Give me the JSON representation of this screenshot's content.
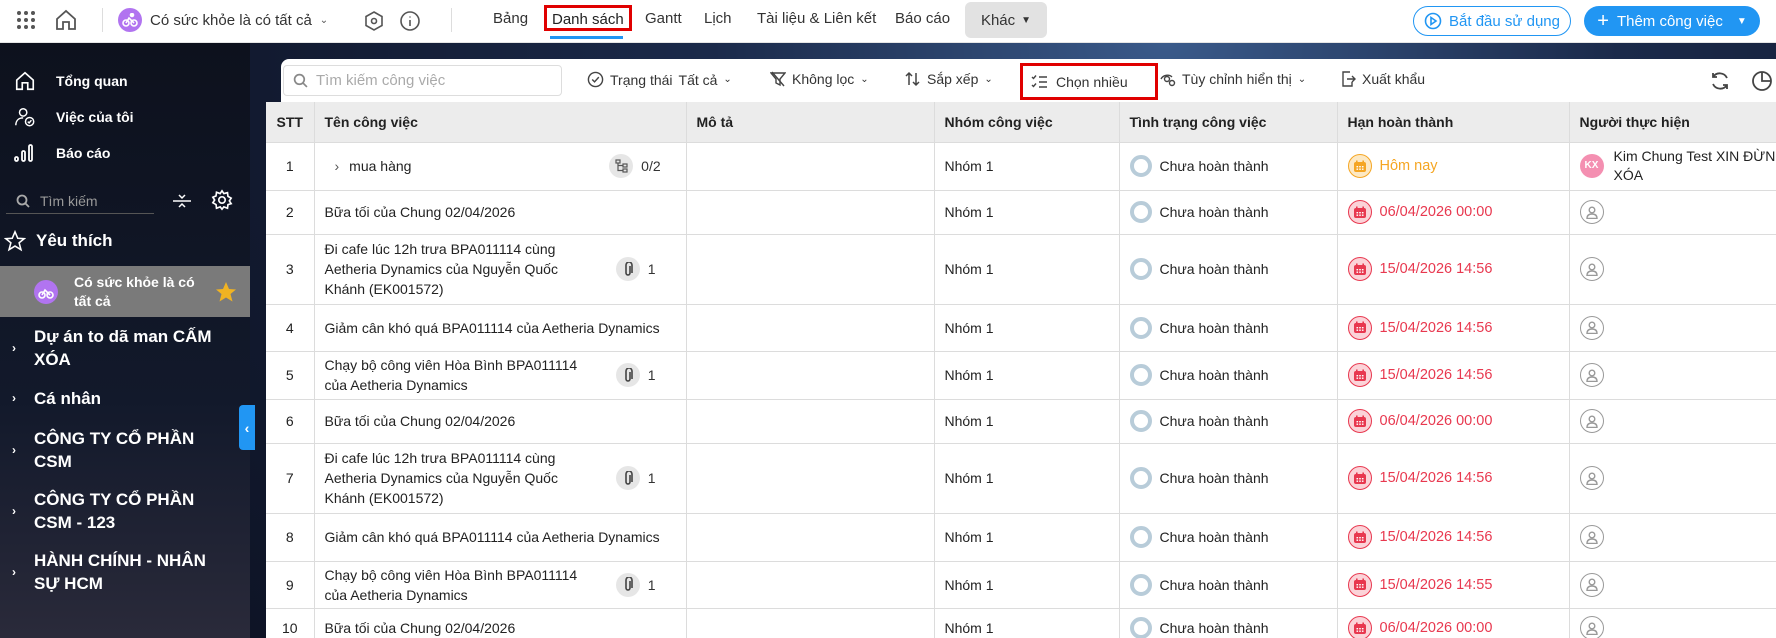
{
  "topbar": {
    "project_name": "Có sức khỏe là có tất cả",
    "tabs": [
      {
        "label": "Bảng"
      },
      {
        "label": "Danh sách",
        "active": true
      },
      {
        "label": "Gantt"
      },
      {
        "label": "Lịch"
      },
      {
        "label": "Tài liệu & Liên kết"
      },
      {
        "label": "Báo cáo"
      }
    ],
    "more_label": "Khác",
    "start_button": "Bắt đầu sử dụng",
    "add_button": "Thêm công việc",
    "accent": "#2196f3",
    "highlight": "#e00000"
  },
  "sidebar": {
    "nav": [
      {
        "label": "Tổng quan",
        "icon": "home-icon"
      },
      {
        "label": "Việc của tôi",
        "icon": "user-check-icon"
      },
      {
        "label": "Báo cáo",
        "icon": "bar-chart-icon"
      }
    ],
    "search_placeholder": "Tìm kiếm",
    "favorites_label": "Yêu thích",
    "favorite_item": "Có sức khỏe là có tất cả",
    "projects": [
      {
        "label": "Dự án to dã man CẤM XÓA"
      },
      {
        "label": "Cá nhân"
      },
      {
        "label": "CÔNG TY CỔ PHẦN CSM"
      },
      {
        "label": "CÔNG TY CỔ PHẦN CSM - 123"
      },
      {
        "label": "HÀNH CHÍNH - NHÂN SỰ HCM"
      }
    ]
  },
  "toolbar": {
    "search_placeholder": "Tìm kiếm công việc",
    "status_label": "Trạng thái",
    "status_value": "Tất cả",
    "filter_label": "Không lọc",
    "sort_label": "Sắp xếp",
    "multi_select_label": "Chọn nhiều",
    "customize_label": "Tùy chỉnh hiển thị",
    "export_label": "Xuất khẩu"
  },
  "table": {
    "columns": [
      "STT",
      "Tên công việc",
      "Mô tả",
      "Nhóm công việc",
      "Tình trạng công việc",
      "Hạn hoàn thành",
      "Người thực hiện"
    ],
    "rows": [
      {
        "stt": "1",
        "name": "mua hàng",
        "expandable": true,
        "badge_type": "subtask",
        "badge": "0/2",
        "desc": "",
        "group": "Nhóm 1",
        "status": "Chưa hoàn thành",
        "due": "Hôm nay",
        "due_color": "#f5a623",
        "assignee": "Kim Chung Test XIN ĐỪNG XÓA",
        "assignee_initials": "KX"
      },
      {
        "stt": "2",
        "name": "Bữa tối của Chung 02/04/2026",
        "badge_type": "",
        "badge": "",
        "desc": "",
        "group": "Nhóm 1",
        "status": "Chưa hoàn thành",
        "due": "06/04/2026 00:00",
        "due_color": "#e8384f",
        "assignee": ""
      },
      {
        "stt": "3",
        "name": "Đi cafe lúc 12h trưa BPA011114 cùng Aetheria Dynamics của Nguyễn Quốc Khánh (EK001572)",
        "badge_type": "attachment",
        "badge": "1",
        "desc": "",
        "group": "Nhóm 1",
        "status": "Chưa hoàn thành",
        "due": "15/04/2026 14:56",
        "due_color": "#e8384f",
        "assignee": ""
      },
      {
        "stt": "4",
        "name": "Giảm cân khó quá BPA011114 của Aetheria Dynamics",
        "badge_type": "",
        "badge": "",
        "desc": "",
        "group": "Nhóm 1",
        "status": "Chưa hoàn thành",
        "due": "15/04/2026 14:56",
        "due_color": "#e8384f",
        "assignee": ""
      },
      {
        "stt": "5",
        "name": "Chạy bộ công viên Hòa Bình BPA011114 của Aetheria Dynamics",
        "badge_type": "attachment",
        "badge": "1",
        "desc": "",
        "group": "Nhóm 1",
        "status": "Chưa hoàn thành",
        "due": "15/04/2026 14:56",
        "due_color": "#e8384f",
        "assignee": ""
      },
      {
        "stt": "6",
        "name": "Bữa tối của Chung 02/04/2026",
        "badge_type": "",
        "badge": "",
        "desc": "",
        "group": "Nhóm 1",
        "status": "Chưa hoàn thành",
        "due": "06/04/2026 00:00",
        "due_color": "#e8384f",
        "assignee": ""
      },
      {
        "stt": "7",
        "name": "Đi cafe lúc 12h trưa BPA011114 cùng Aetheria Dynamics của Nguyễn Quốc Khánh (EK001572)",
        "badge_type": "attachment",
        "badge": "1",
        "desc": "",
        "group": "Nhóm 1",
        "status": "Chưa hoàn thành",
        "due": "15/04/2026 14:56",
        "due_color": "#e8384f",
        "assignee": ""
      },
      {
        "stt": "8",
        "name": "Giảm cân khó quá BPA011114 của Aetheria Dynamics",
        "badge_type": "",
        "badge": "",
        "desc": "",
        "group": "Nhóm 1",
        "status": "Chưa hoàn thành",
        "due": "15/04/2026 14:56",
        "due_color": "#e8384f",
        "assignee": ""
      },
      {
        "stt": "9",
        "name": "Chạy bộ công viên Hòa Bình BPA011114 của Aetheria Dynamics",
        "badge_type": "attachment",
        "badge": "1",
        "desc": "",
        "group": "Nhóm 1",
        "status": "Chưa hoàn thành",
        "due": "15/04/2026 14:55",
        "due_color": "#e8384f",
        "assignee": ""
      },
      {
        "stt": "10",
        "name": "Bữa tối của Chung 02/04/2026",
        "badge_type": "",
        "badge": "",
        "desc": "",
        "group": "Nhóm 1",
        "status": "Chưa hoàn thành",
        "due": "06/04/2026 00:00",
        "due_color": "#e8384f",
        "assignee": ""
      }
    ]
  }
}
